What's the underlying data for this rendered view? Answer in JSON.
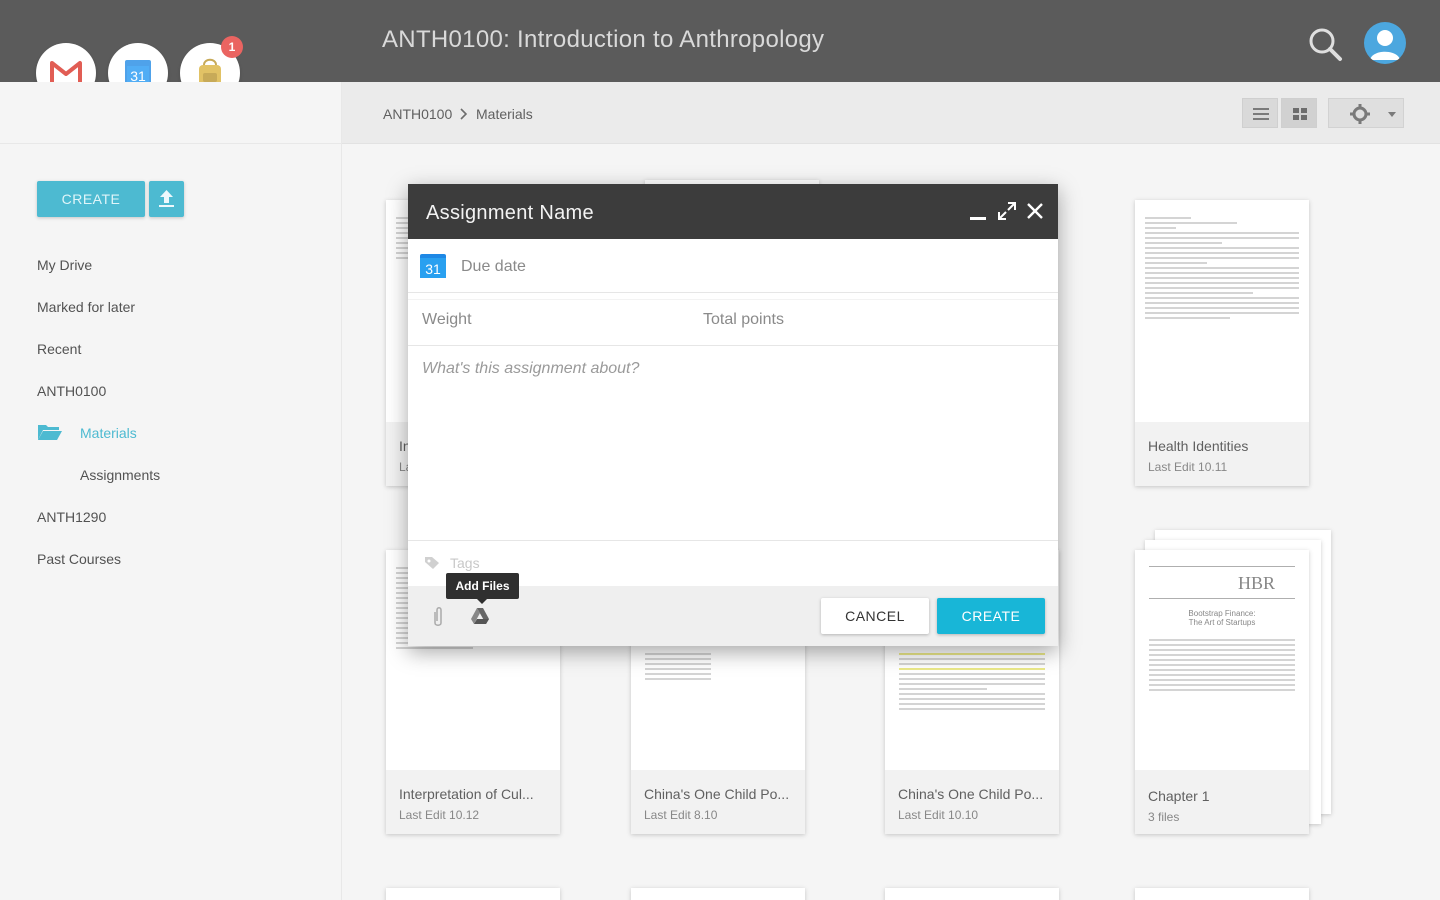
{
  "header": {
    "title": "ANTH0100: Introduction to Anthropology",
    "notification_count": "1",
    "apps": [
      "gmail-icon",
      "calendar-icon",
      "backpack-icon"
    ],
    "calendar_day": "31"
  },
  "breadcrumb": {
    "course": "ANTH0100",
    "current": "Materials"
  },
  "sidebar": {
    "create_label": "CREATE",
    "items": [
      {
        "label": "My Drive"
      },
      {
        "label": "Marked for later"
      },
      {
        "label": "Recent"
      },
      {
        "label": "ANTH0100"
      },
      {
        "label": "Materials"
      },
      {
        "label": "Assignments"
      },
      {
        "label": "ANTH1290"
      },
      {
        "label": "Past Courses"
      }
    ]
  },
  "cards": [
    {
      "name": "In",
      "sub": "La"
    },
    {
      "name": "Health Identities",
      "sub": "Last Edit 10.11"
    },
    {
      "name": "Interpretation of Cul...",
      "sub": "Last Edit 10.12"
    },
    {
      "name": "China's One Child Po...",
      "sub": "Last Edit 8.10"
    },
    {
      "name": "China's One Child Po...",
      "sub": "Last Edit 10.10"
    },
    {
      "name": "Chapter 1",
      "sub": "3 files"
    }
  ],
  "hbr": {
    "logo": "HBR",
    "title_line1": "Bootstrap Finance:",
    "title_line2": "The Art of Startups"
  },
  "dialog": {
    "title": "Assignment Name",
    "due_date_placeholder": "Due date",
    "weight_placeholder": "Weight",
    "total_points_placeholder": "Total points",
    "description_placeholder": "What's this assignment about?",
    "tags_placeholder": "Tags",
    "tooltip": "Add Files",
    "cancel_label": "CANCEL",
    "create_label": "CREATE"
  },
  "colors": {
    "accent": "#1ba7c4",
    "topbar": "#2e2e2e",
    "dialog_header": "#3c3c3c",
    "badge": "#e53935"
  }
}
